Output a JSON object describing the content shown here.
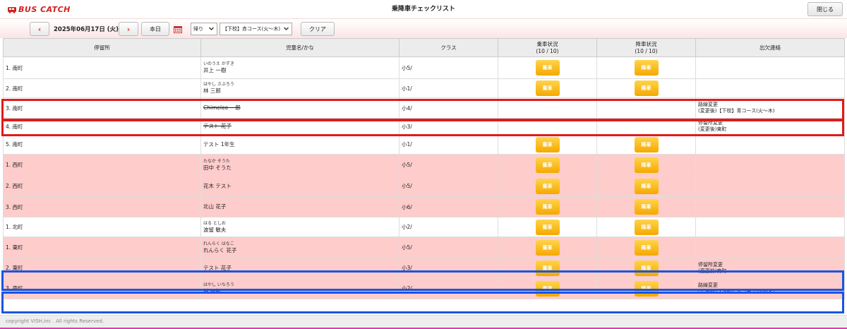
{
  "app": {
    "logo_text": "BUS CATCH",
    "title": "乗降車チェックリスト",
    "close_label": "閉じる"
  },
  "toolbar": {
    "prev_label": "‹",
    "date": "2025年06月17日 (火)",
    "next_label": "›",
    "today_label": "本日",
    "direction_value": "帰り",
    "course_value": "【下校】赤コース(火～木)",
    "clear_label": "クリア"
  },
  "table": {
    "headers": {
      "stop": "停留所",
      "name": "児童名/かな",
      "class": "クラス",
      "board": "乗車状況",
      "board_count": "(10 / 10)",
      "alight": "降車状況",
      "alight_count": "(10 / 10)",
      "contact": "出欠連絡"
    },
    "board_button": "乗車",
    "alight_button": "降車",
    "rows": [
      {
        "stop": "1. 南町",
        "kana": "いのうえ かずき",
        "name": "井上 一樹",
        "class": "小5/",
        "board": true,
        "alight": true,
        "notice1": "",
        "notice2": "",
        "strike": false,
        "bg": "white"
      },
      {
        "stop": "2. 南町",
        "kana": "はやし さぶろう",
        "name": "林 三郎",
        "class": "小1/",
        "board": true,
        "alight": true,
        "notice1": "",
        "notice2": "",
        "strike": false,
        "bg": "white"
      },
      {
        "stop": "3. 南町",
        "kana": "",
        "name": "Chimelee 一郎",
        "class": "小4/",
        "board": false,
        "alight": false,
        "notice1": "路線変更",
        "notice2": "(変更後)【下校】青コース(火～木)",
        "strike": true,
        "bg": "white"
      },
      {
        "stop": "4. 南町",
        "kana": "",
        "name": "テスト 花子",
        "class": "小3/",
        "board": false,
        "alight": false,
        "notice1": "停留所変更",
        "notice2": "(変更後)東町",
        "strike": true,
        "bg": "white"
      },
      {
        "stop": "5. 南町",
        "kana": "",
        "name": "テスト 1年生",
        "class": "小1/",
        "board": true,
        "alight": true,
        "notice1": "",
        "notice2": "",
        "strike": false,
        "bg": "white"
      },
      {
        "stop": "1. 西町",
        "kana": "たなか そうた",
        "name": "田中 そうた",
        "class": "小5/",
        "board": true,
        "alight": true,
        "notice1": "",
        "notice2": "",
        "strike": false,
        "bg": "pink"
      },
      {
        "stop": "2. 西町",
        "kana": "",
        "name": "花木 テスト",
        "class": "小5/",
        "board": true,
        "alight": true,
        "notice1": "",
        "notice2": "",
        "strike": false,
        "bg": "pink"
      },
      {
        "stop": "3. 西町",
        "kana": "",
        "name": "北山 花子",
        "class": "小6/",
        "board": true,
        "alight": true,
        "notice1": "",
        "notice2": "",
        "strike": false,
        "bg": "pink"
      },
      {
        "stop": "1. 北町",
        "kana": "はる としお",
        "name": "波留 敏夫",
        "class": "小2/",
        "board": true,
        "alight": true,
        "notice1": "",
        "notice2": "",
        "strike": false,
        "bg": "white"
      },
      {
        "stop": "1. 東町",
        "kana": "れんらく はなこ",
        "name": "れんらく 花子",
        "class": "小5/",
        "board": true,
        "alight": true,
        "notice1": "",
        "notice2": "",
        "strike": false,
        "bg": "pink"
      },
      {
        "stop": "2. 東町",
        "kana": "",
        "name": "テスト 花子",
        "class": "小3/",
        "board": true,
        "alight": true,
        "notice1": "停留所変更",
        "notice2": "(変更前)南町",
        "strike": false,
        "bg": "pink"
      },
      {
        "stop": "3. 東町",
        "kana": "はやし いちろう",
        "name": "林 一郎",
        "class": "小2/",
        "board": true,
        "alight": true,
        "notice1": "路線変更",
        "notice2": "(変更前)【下校】青コース(火～木)",
        "strike": false,
        "bg": "pink"
      }
    ]
  },
  "footer": {
    "copyright": "copyright VISH,inc . All rights Reserved."
  },
  "colors": {
    "brand_red": "#d42020",
    "row_pink": "#ffcccc",
    "status_button": "#f5a800",
    "highlight_red": "#e01b1b",
    "highlight_blue": "#1a55e0",
    "footer_accent": "#e23bb0"
  }
}
